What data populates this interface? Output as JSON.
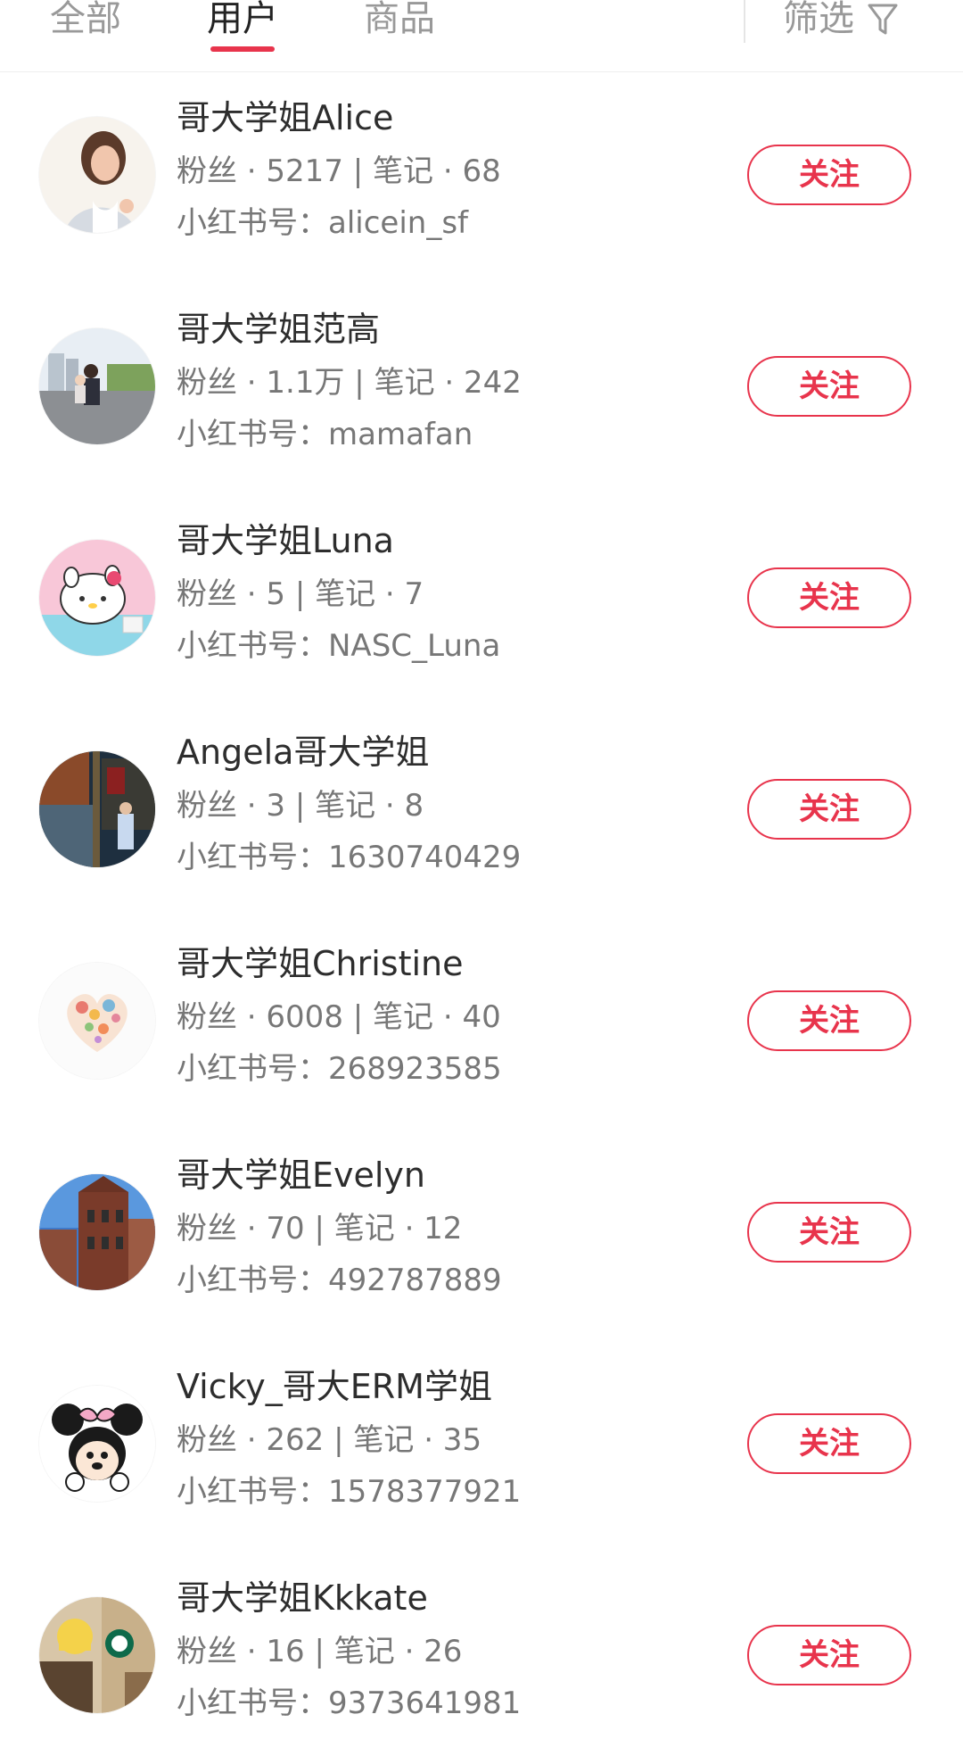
{
  "tabs": {
    "all": "全部",
    "users": "用户",
    "goods": "商品",
    "filter": "筛选"
  },
  "accent_color": "#e8344c",
  "users": [
    {
      "name": "哥大学姐Alice",
      "stats": "粉丝 · 5217 | 笔记 · 68",
      "handle": "小红书号：alicein_sf",
      "follow": "关注",
      "avatar_icon": "woman-photo"
    },
    {
      "name": "哥大学姐范高",
      "stats": "粉丝 · 1.1万 | 笔记 · 242",
      "handle": "小红书号：mamafan",
      "follow": "关注",
      "avatar_icon": "people-city-photo"
    },
    {
      "name": "哥大学姐Luna",
      "stats": "粉丝 · 5 | 笔记 · 7",
      "handle": "小红书号：NASC_Luna",
      "follow": "关注",
      "avatar_icon": "hello-kitty"
    },
    {
      "name": "Angela哥大学姐",
      "stats": "粉丝 · 3 | 笔记 · 8",
      "handle": "小红书号：1630740429",
      "follow": "关注",
      "avatar_icon": "street-photo"
    },
    {
      "name": "哥大学姐Christine",
      "stats": "粉丝 · 6008 | 笔记 · 40",
      "handle": "小红书号：268923585",
      "follow": "关注",
      "avatar_icon": "flower-heart"
    },
    {
      "name": "哥大学姐Evelyn",
      "stats": "粉丝 · 70 | 笔记 · 12",
      "handle": "小红书号：492787889",
      "follow": "关注",
      "avatar_icon": "campus-building-photo"
    },
    {
      "name": "Vicky_哥大ERM学姐",
      "stats": "粉丝 · 262 | 笔记 · 35",
      "handle": "小红书号：1578377921",
      "follow": "关注",
      "avatar_icon": "minnie-mouse"
    },
    {
      "name": "哥大学姐Kkkate",
      "stats": "粉丝 · 16 | 笔记 · 26",
      "handle": "小红书号：9373641981",
      "follow": "关注",
      "avatar_icon": "starbucks-photo"
    }
  ]
}
